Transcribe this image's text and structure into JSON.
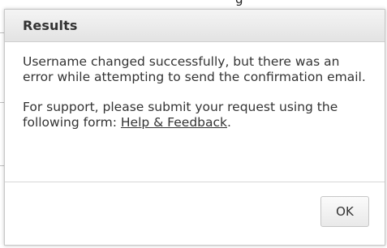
{
  "background": {
    "partial_text": "g"
  },
  "dialog": {
    "title": "Results",
    "message_line1": "Username changed successfully, but there was an error while attempting to send the confirmation email.",
    "support_prefix": "For support, please submit your request using the following form: ",
    "support_link": "Help & Feedback",
    "support_suffix": ".",
    "ok_label": "OK"
  }
}
